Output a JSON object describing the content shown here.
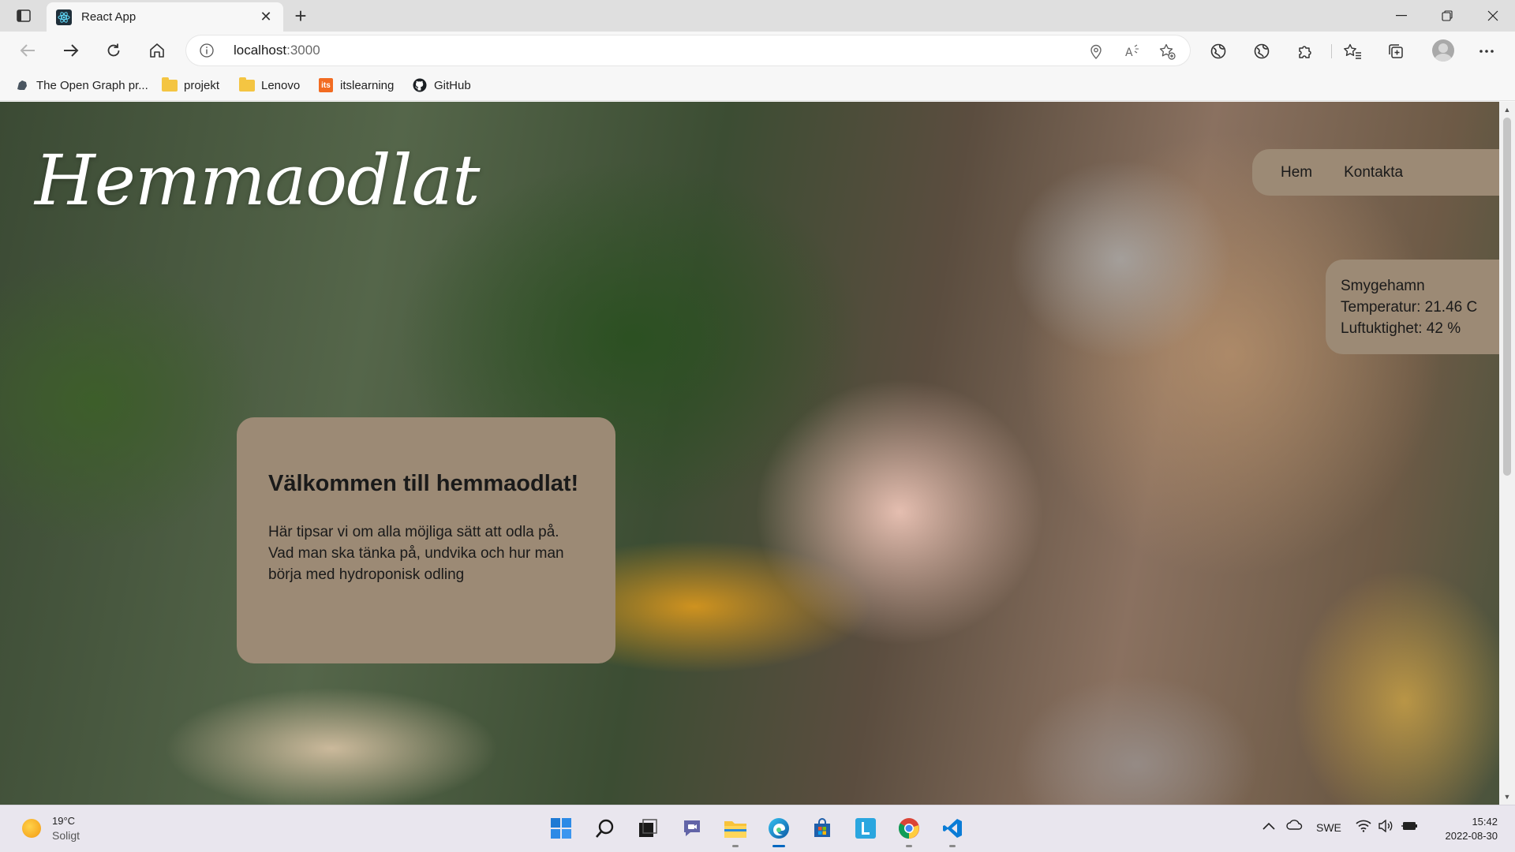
{
  "browser": {
    "tab_title": "React App",
    "new_tab_symbol": "+",
    "address": {
      "host": "localhost",
      "port": ":3000"
    },
    "bookmarks": [
      {
        "label": "The Open Graph pr...",
        "icon": "open-graph-icon"
      },
      {
        "label": "projekt",
        "icon": "folder-icon"
      },
      {
        "label": "Lenovo",
        "icon": "folder-icon"
      },
      {
        "label": "itslearning",
        "icon": "itslearning-icon"
      },
      {
        "label": "GitHub",
        "icon": "github-icon"
      }
    ],
    "itslearning_badge": "its"
  },
  "page": {
    "logo": "Hemmaodlat",
    "nav": {
      "home": "Hem",
      "contact": "Kontakta"
    },
    "weather": {
      "city": "Smygehamn",
      "temperature": "Temperatur: 21.46 C",
      "humidity": "Luftuktighet: 42 %"
    },
    "welcome": {
      "title": "Välkommen till hemmaodlat!",
      "text": "Här tipsar vi om alla möjliga sätt att odla på. Vad man ska tänka på, undvika och hur man börja med hydroponisk odling"
    },
    "scroll_fraction": 0.51
  },
  "taskbar": {
    "weather_temp": "19°C",
    "weather_cond": "Soligt",
    "language": "SWE",
    "time": "15:42",
    "date": "2022-08-30"
  },
  "colors": {
    "panel": "#9c8a75",
    "accent": "#0067c0"
  }
}
